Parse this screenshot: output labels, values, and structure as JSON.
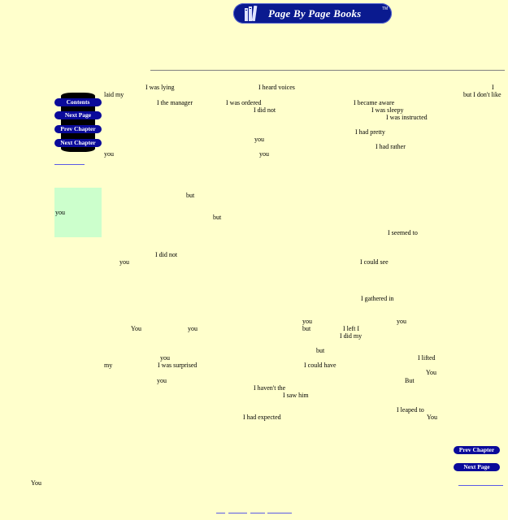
{
  "logo": {
    "text": "Page By Page Books",
    "trademark": "TM"
  },
  "nav_left": {
    "contents": "Contents",
    "next_page": "Next Page",
    "prev_chapter": "Prev Chapter",
    "next_chapter": "Next Chapter"
  },
  "nav_right": {
    "prev_chapter": "Prev Chapter",
    "next_page": "Next Page"
  },
  "text": {
    "t1": "I was lying",
    "t2": "I heard voices",
    "t3": "I",
    "t4": "laid my",
    "t5": "but I don't like",
    "t6": "I the manager",
    "t7": "I was ordered",
    "t8": "I became aware",
    "t9": "I did not",
    "t10": "I was sleepy",
    "t11": "I was instructed",
    "t12": "I had pretty",
    "t13": "you",
    "t14": "I had rather",
    "t15": "you",
    "t16": "you",
    "t17": "but",
    "t18": "you",
    "t19": "but",
    "t20": "I seemed to",
    "t21": "I did not",
    "t22": "you",
    "t23": "I could see",
    "t24": "I gathered in",
    "t25": "you",
    "t26": "you",
    "t27": "You",
    "t28": "you",
    "t29": "but",
    "t30": "I left I",
    "t31": "I did my",
    "t32": "but",
    "t33": "you",
    "t34": "I lifted",
    "t35": "my",
    "t36": "I was surprised",
    "t37": "I could have",
    "t38": "You",
    "t39": "you",
    "t40": "But",
    "t41": "I haven't the",
    "t42": "I saw him",
    "t43": "I leaped to",
    "t44": "I had expected",
    "t45": "You",
    "t46": "You"
  },
  "colors": {
    "background": "#ffffcc",
    "nav_button": "#0a0a9a",
    "logo_bg": "#0a1a8f",
    "link": "#5a5ae6",
    "box": "#ccffcc"
  }
}
